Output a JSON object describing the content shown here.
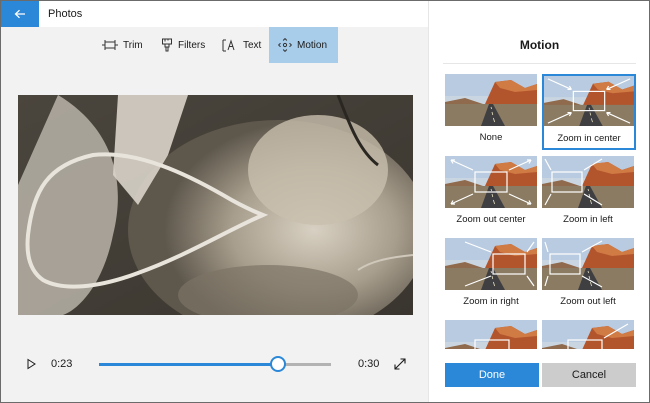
{
  "titlebar": {
    "title": "Photos",
    "back_icon": "back-arrow-icon",
    "controls": [
      "minimize-icon",
      "maximize-icon",
      "close-icon"
    ],
    "accent": "#2b88d8"
  },
  "toolbar": {
    "tools": [
      {
        "label": "Trim",
        "icon": "trim-icon",
        "active": false
      },
      {
        "label": "Filters",
        "icon": "filters-icon",
        "active": false
      },
      {
        "label": "Text",
        "icon": "text-icon",
        "active": false
      },
      {
        "label": "Motion",
        "icon": "motion-icon",
        "active": true
      }
    ],
    "active_color": "#a8cdea"
  },
  "playback": {
    "current_time": "0:23",
    "total_time": "0:30",
    "progress": 0.77,
    "play_icon": "play-icon",
    "expand_icon": "expand-icon"
  },
  "panel": {
    "title": "Motion",
    "options": [
      {
        "label": "None",
        "selected": false
      },
      {
        "label": "Zoom in center",
        "selected": true
      },
      {
        "label": "Zoom out center",
        "selected": false
      },
      {
        "label": "Zoom in left",
        "selected": false
      },
      {
        "label": "Zoom in right",
        "selected": false
      },
      {
        "label": "Zoom out left",
        "selected": false
      },
      {
        "label": "",
        "selected": false
      },
      {
        "label": "",
        "selected": false
      }
    ],
    "done_label": "Done",
    "cancel_label": "Cancel"
  }
}
